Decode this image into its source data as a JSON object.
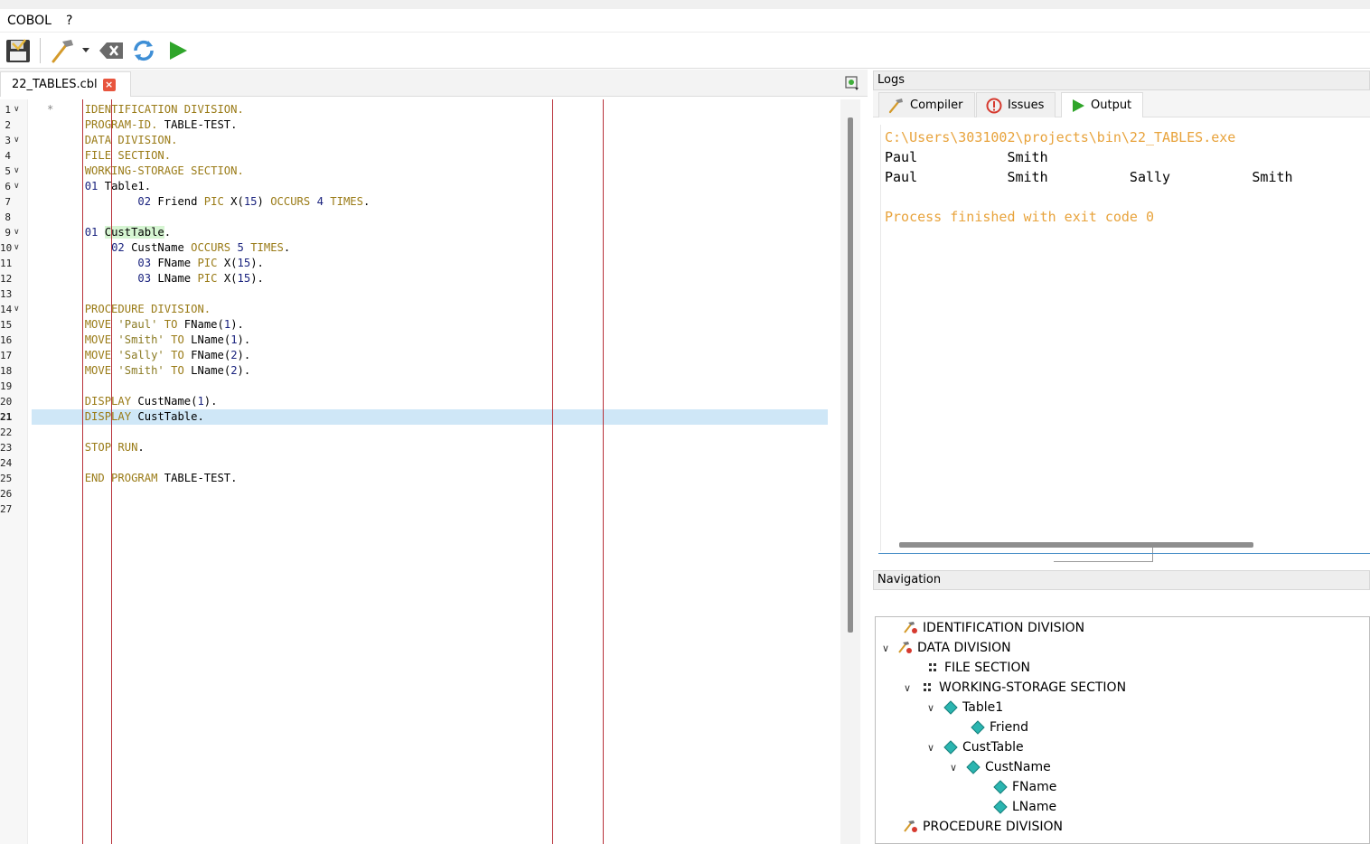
{
  "menu": {
    "items": [
      "COBOL",
      "?"
    ]
  },
  "editor": {
    "tab_name": "22_TABLES.cbl",
    "tab_close": "×",
    "line_numbers": [
      "1",
      "2",
      "3",
      "4",
      "5",
      "6",
      "7",
      "8",
      "9",
      "10",
      "11",
      "12",
      "13",
      "14",
      "15",
      "16",
      "17",
      "18",
      "19",
      "20",
      "21",
      "22",
      "23",
      "24",
      "25",
      "26",
      "27"
    ],
    "current_line": 21
  },
  "logs": {
    "title": "Logs",
    "tabs": [
      "Compiler",
      "Issues",
      "Output"
    ],
    "active_tab": "Output",
    "output_path": "C:\\Users\\3031002\\projects\\bin\\22_TABLES.exe",
    "output_line1": "Paul           Smith",
    "output_line2": "Paul           Smith          Sally          Smith",
    "exit_message": "Process finished with exit code 0"
  },
  "navigation": {
    "title": "Navigation",
    "nodes": [
      "IDENTIFICATION DIVISION",
      "DATA DIVISION",
      "FILE SECTION",
      "WORKING-STORAGE SECTION",
      "Table1",
      "Friend",
      "CustTable",
      "CustName",
      "FName",
      "LName",
      "PROCEDURE DIVISION"
    ]
  },
  "colors": {
    "accent_blue": "#4a90c8",
    "ruler_red": "#b8323a",
    "output_orange": "#e8a33c",
    "current_line": "#cfe7f7"
  }
}
